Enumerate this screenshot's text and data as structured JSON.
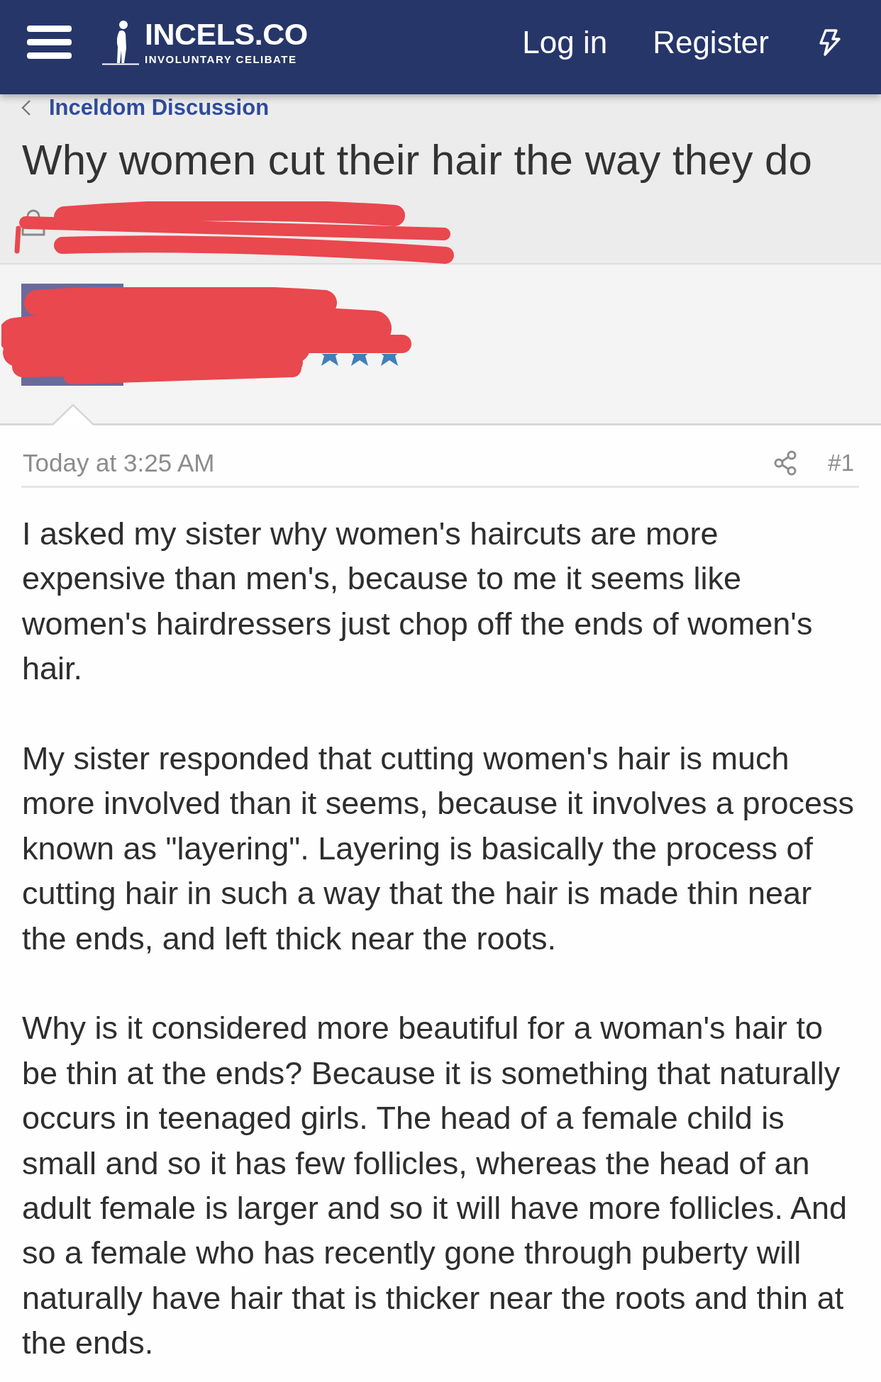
{
  "header": {
    "logo": {
      "name": "INCELS.CO",
      "tagline": "INVOLUNTARY CELIBATE"
    },
    "links": [
      {
        "label": "Log in"
      },
      {
        "label": "Register"
      }
    ]
  },
  "breadcrumb": {
    "label": "Inceldom Discussion"
  },
  "thread": {
    "title": "Why women cut their hair the way they do"
  },
  "post": {
    "time": "Today at 3:25 AM",
    "number": "#1",
    "paragraphs": [
      "I asked my sister why women's haircuts are more expensive than men's, because to me it seems like women's hairdressers just chop off the ends of women's hair.",
      "My sister responded that cutting women's hair is much more involved than it seems, because it involves a process known as \"layering\". Layering is basically the process of cutting hair in such a way that the hair is made thin near the ends, and left thick near the roots.",
      "Why is it considered more beautiful for a woman's hair to be thin at the ends? Because it is something that naturally occurs in teenaged girls. The head of a female child is small and so it has few follicles, whereas the head of an adult female is larger and so it will have more follicles. And so a female who has recently gone through puberty will naturally have hair that is thicker near the roots and thin at the ends."
    ]
  }
}
